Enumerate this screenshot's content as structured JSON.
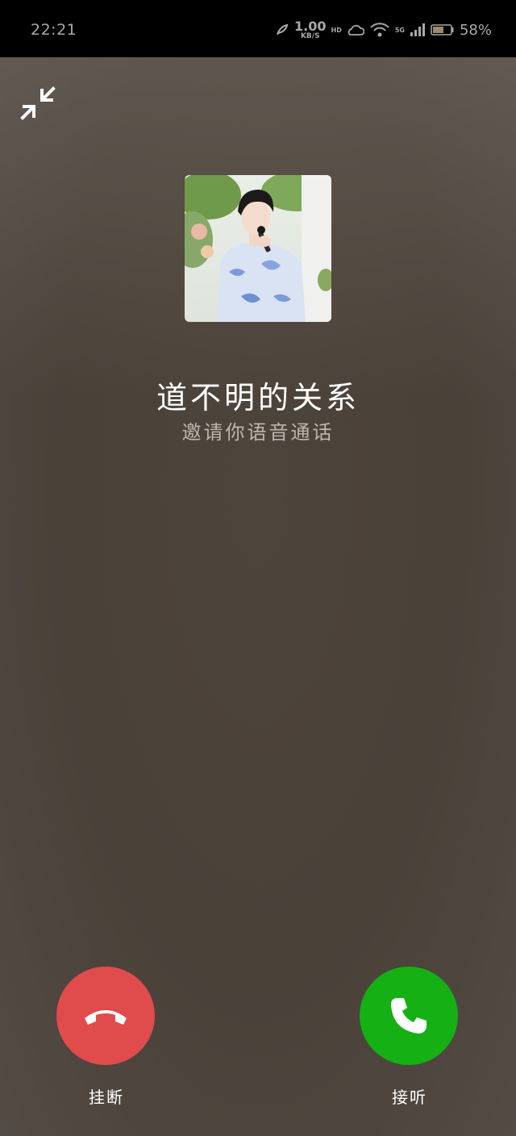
{
  "status_bar": {
    "time": "22:21",
    "net_speed_value": "1.00",
    "net_speed_unit": "KB/S",
    "hd_label": "HD",
    "network_label": "5G",
    "battery_text": "58%"
  },
  "call": {
    "caller_name": "道不明的关系",
    "subtitle": "邀请你语音通话",
    "hangup_label": "挂断",
    "answer_label": "接听"
  },
  "colors": {
    "hangup": "#e04b4b",
    "answer": "#14b014",
    "background": "#4a4139"
  },
  "icons": {
    "minimize": "minimize-arrows-icon",
    "hangup": "phone-hangup-icon",
    "answer": "phone-icon",
    "avatar": "caller-avatar-image"
  }
}
